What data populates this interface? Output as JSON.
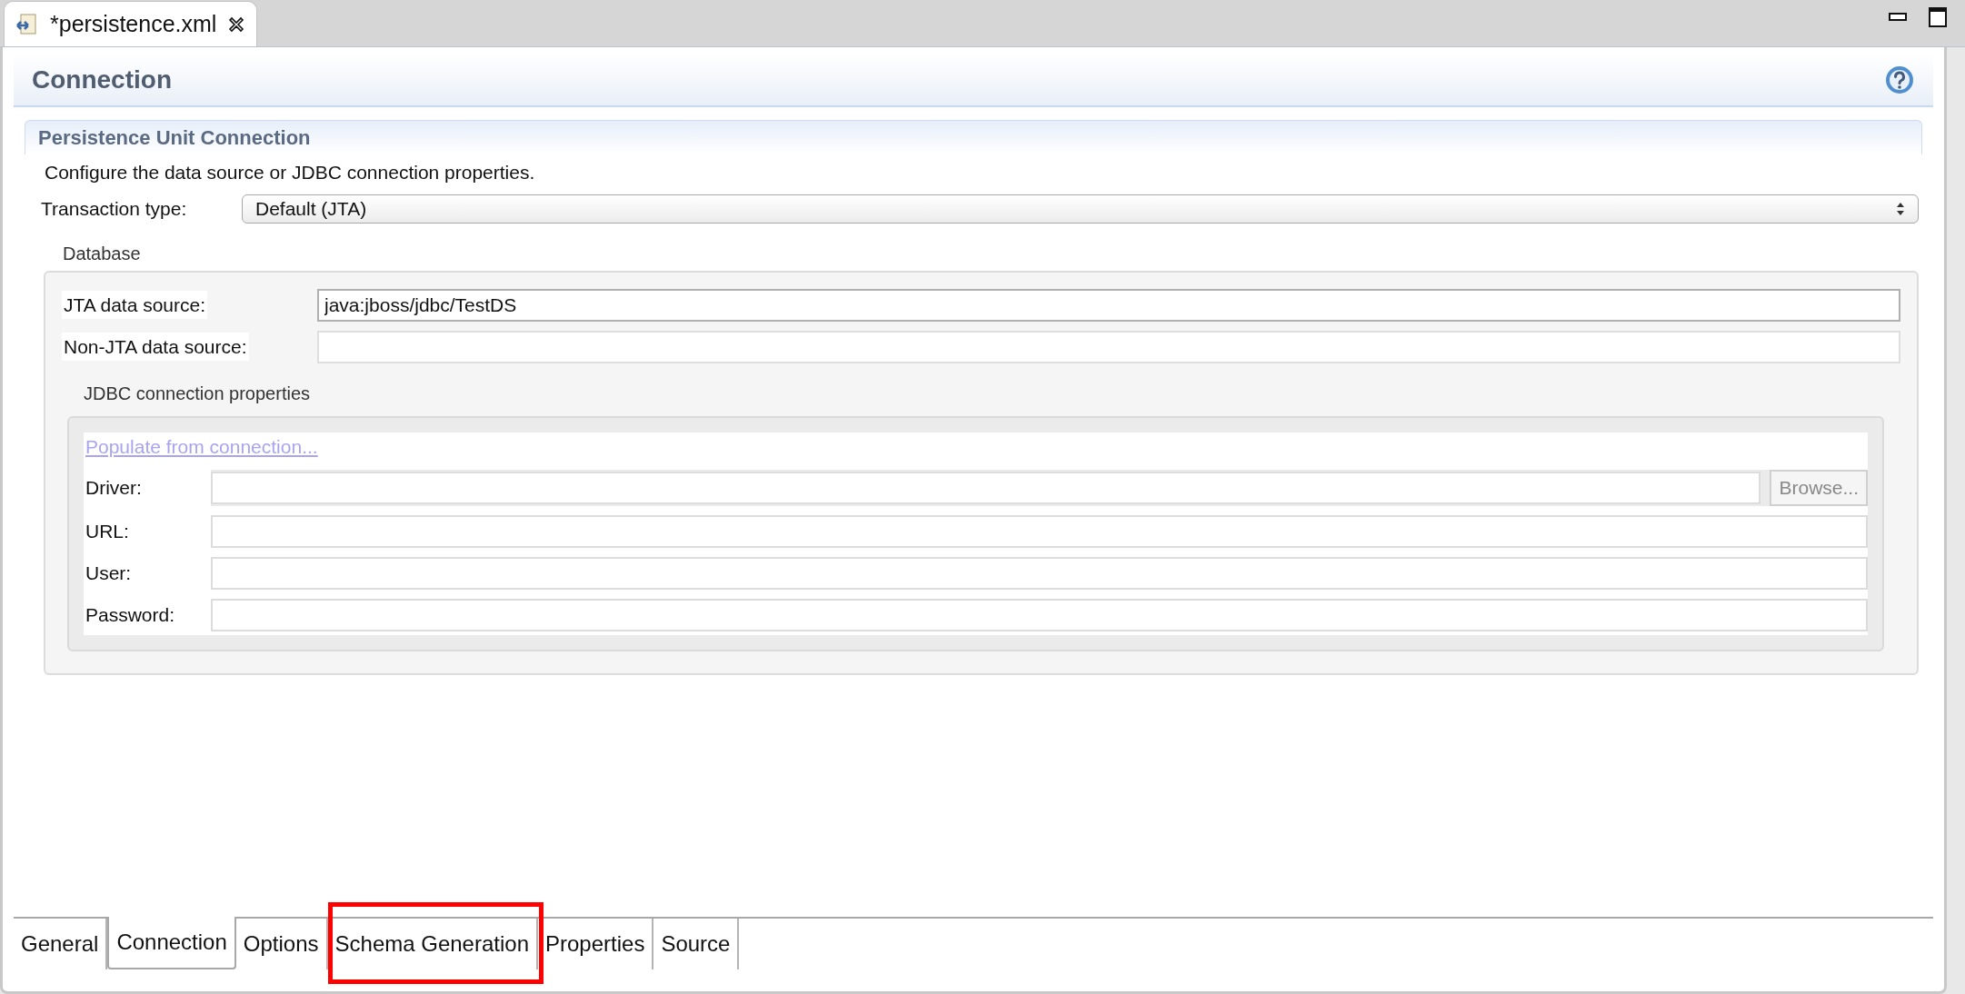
{
  "editor_tab": {
    "title": "*persistence.xml"
  },
  "page_title": "Connection",
  "section": {
    "title": "Persistence Unit Connection",
    "description": "Configure the data source or JDBC connection properties."
  },
  "transaction_type": {
    "label": "Transaction type:",
    "value": "Default (JTA)"
  },
  "database": {
    "title": "Database",
    "fields": [
      {
        "label": "JTA data source:",
        "value": "java:jboss/jdbc/TestDS"
      },
      {
        "label": "Non-JTA data source:"
      }
    ]
  },
  "jdbc": {
    "title": "JDBC connection properties",
    "link": "Populate from connection...",
    "disabled": true,
    "fields": [
      {
        "label": "Driver:",
        "button": "Browse..."
      },
      {
        "label": "URL:"
      },
      {
        "label": "User:"
      },
      {
        "label": "Password:"
      }
    ]
  },
  "bottom_tabs": [
    {
      "label": "General",
      "selected": false,
      "highlighted": false
    },
    {
      "label": "Connection",
      "selected": true,
      "highlighted": false
    },
    {
      "label": "Options",
      "selected": false,
      "highlighted": false
    },
    {
      "label": "Schema Generation",
      "selected": false,
      "highlighted": true
    },
    {
      "label": "Properties",
      "selected": false,
      "highlighted": false
    },
    {
      "label": "Source",
      "selected": false,
      "highlighted": false
    }
  ]
}
